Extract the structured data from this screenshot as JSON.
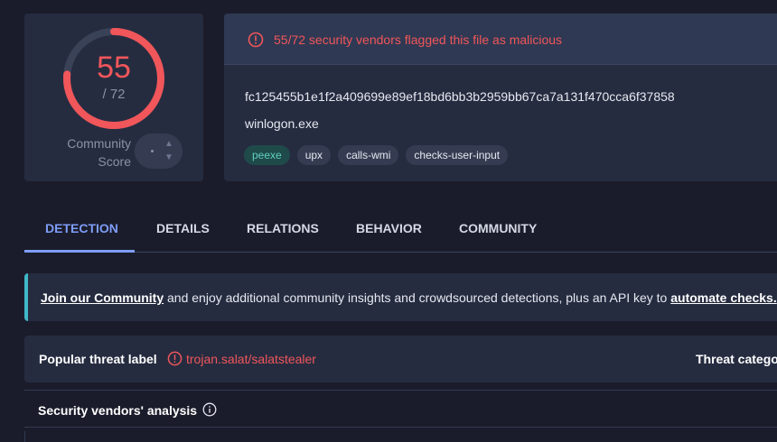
{
  "score": {
    "detections": "55",
    "total": "/ 72",
    "detection_fraction": 0.7639,
    "community_label_line1": "Community",
    "community_label_line2": "Score",
    "vote_up_icon": "chevron-up-icon",
    "vote_down_icon": "chevron-down-icon"
  },
  "alert": {
    "icon": "alert-circle-icon",
    "text": "55/72 security vendors flagged this file as malicious"
  },
  "file": {
    "hash": "fc125455b1e1f2a409699e89ef18bd6bb3b2959bb67ca7a131f470cca6f37858",
    "name": "winlogon.exe",
    "tags": [
      "peexe",
      "upx",
      "calls-wmi",
      "checks-user-input"
    ]
  },
  "tabs": [
    "DETECTION",
    "DETAILS",
    "RELATIONS",
    "BEHAVIOR",
    "COMMUNITY"
  ],
  "banner": {
    "link1": "Join our Community",
    "middle": " and enjoy additional community insights and crowdsourced detections, plus an API key to ",
    "link2": "automate checks."
  },
  "threat": {
    "label": "Popular threat label",
    "value": "trojan.salat/salatstealer",
    "category_label": "Threat categories"
  },
  "vendors": {
    "label": "Security vendors' analysis",
    "info_icon": "info-icon"
  },
  "colors": {
    "accent": "#7e9df7",
    "malicious": "#f0565a",
    "background": "#1b1c2b",
    "card": "#262c40"
  }
}
